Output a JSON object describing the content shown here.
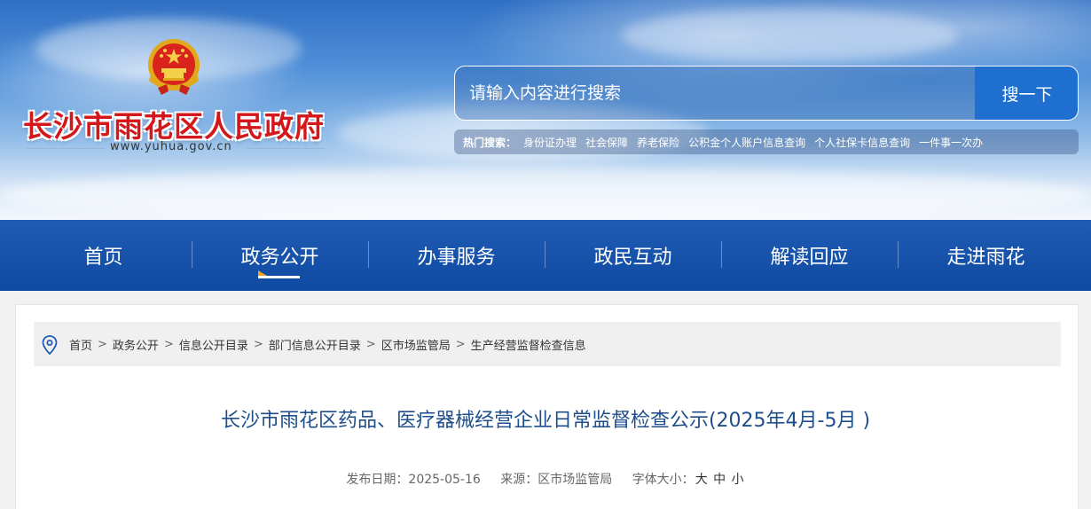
{
  "header": {
    "site_title": "长沙市雨花区人民政府",
    "site_url": "www.yuhua.gov.cn",
    "search": {
      "placeholder": "请输入内容进行搜索",
      "button_label": "搜一下"
    },
    "hot_search": {
      "label": "热门搜索：",
      "items": [
        "身份证办理",
        "社会保障",
        "养老保险",
        "公积金个人账户信息查询",
        "个人社保卡信息查询",
        "一件事一次办"
      ]
    }
  },
  "nav": {
    "items": [
      "首页",
      "政务公开",
      "办事服务",
      "政民互动",
      "解读回应",
      "走进雨花"
    ],
    "active": "政务公开"
  },
  "breadcrumb": {
    "items": [
      "首页",
      "政务公开",
      "信息公开目录",
      "部门信息公开目录",
      "区市场监管局",
      "生产经营监督检查信息"
    ],
    "separator": ">"
  },
  "article": {
    "title": "长沙市雨花区药品、医疗器械经营企业日常监督检查公示(2025年4月-5月 )",
    "publish_label": "发布日期：",
    "publish_date": "2025-05-16",
    "source_label": "来源：",
    "source": "区市场监管局",
    "font_size_label": "字体大小：",
    "font_sizes": [
      "大",
      "中",
      "小"
    ]
  },
  "colors": {
    "nav_bg": "#1452aa",
    "title_red": "#d3171b",
    "article_title": "#1e4e8c",
    "search_button": "#1f6fd0"
  }
}
